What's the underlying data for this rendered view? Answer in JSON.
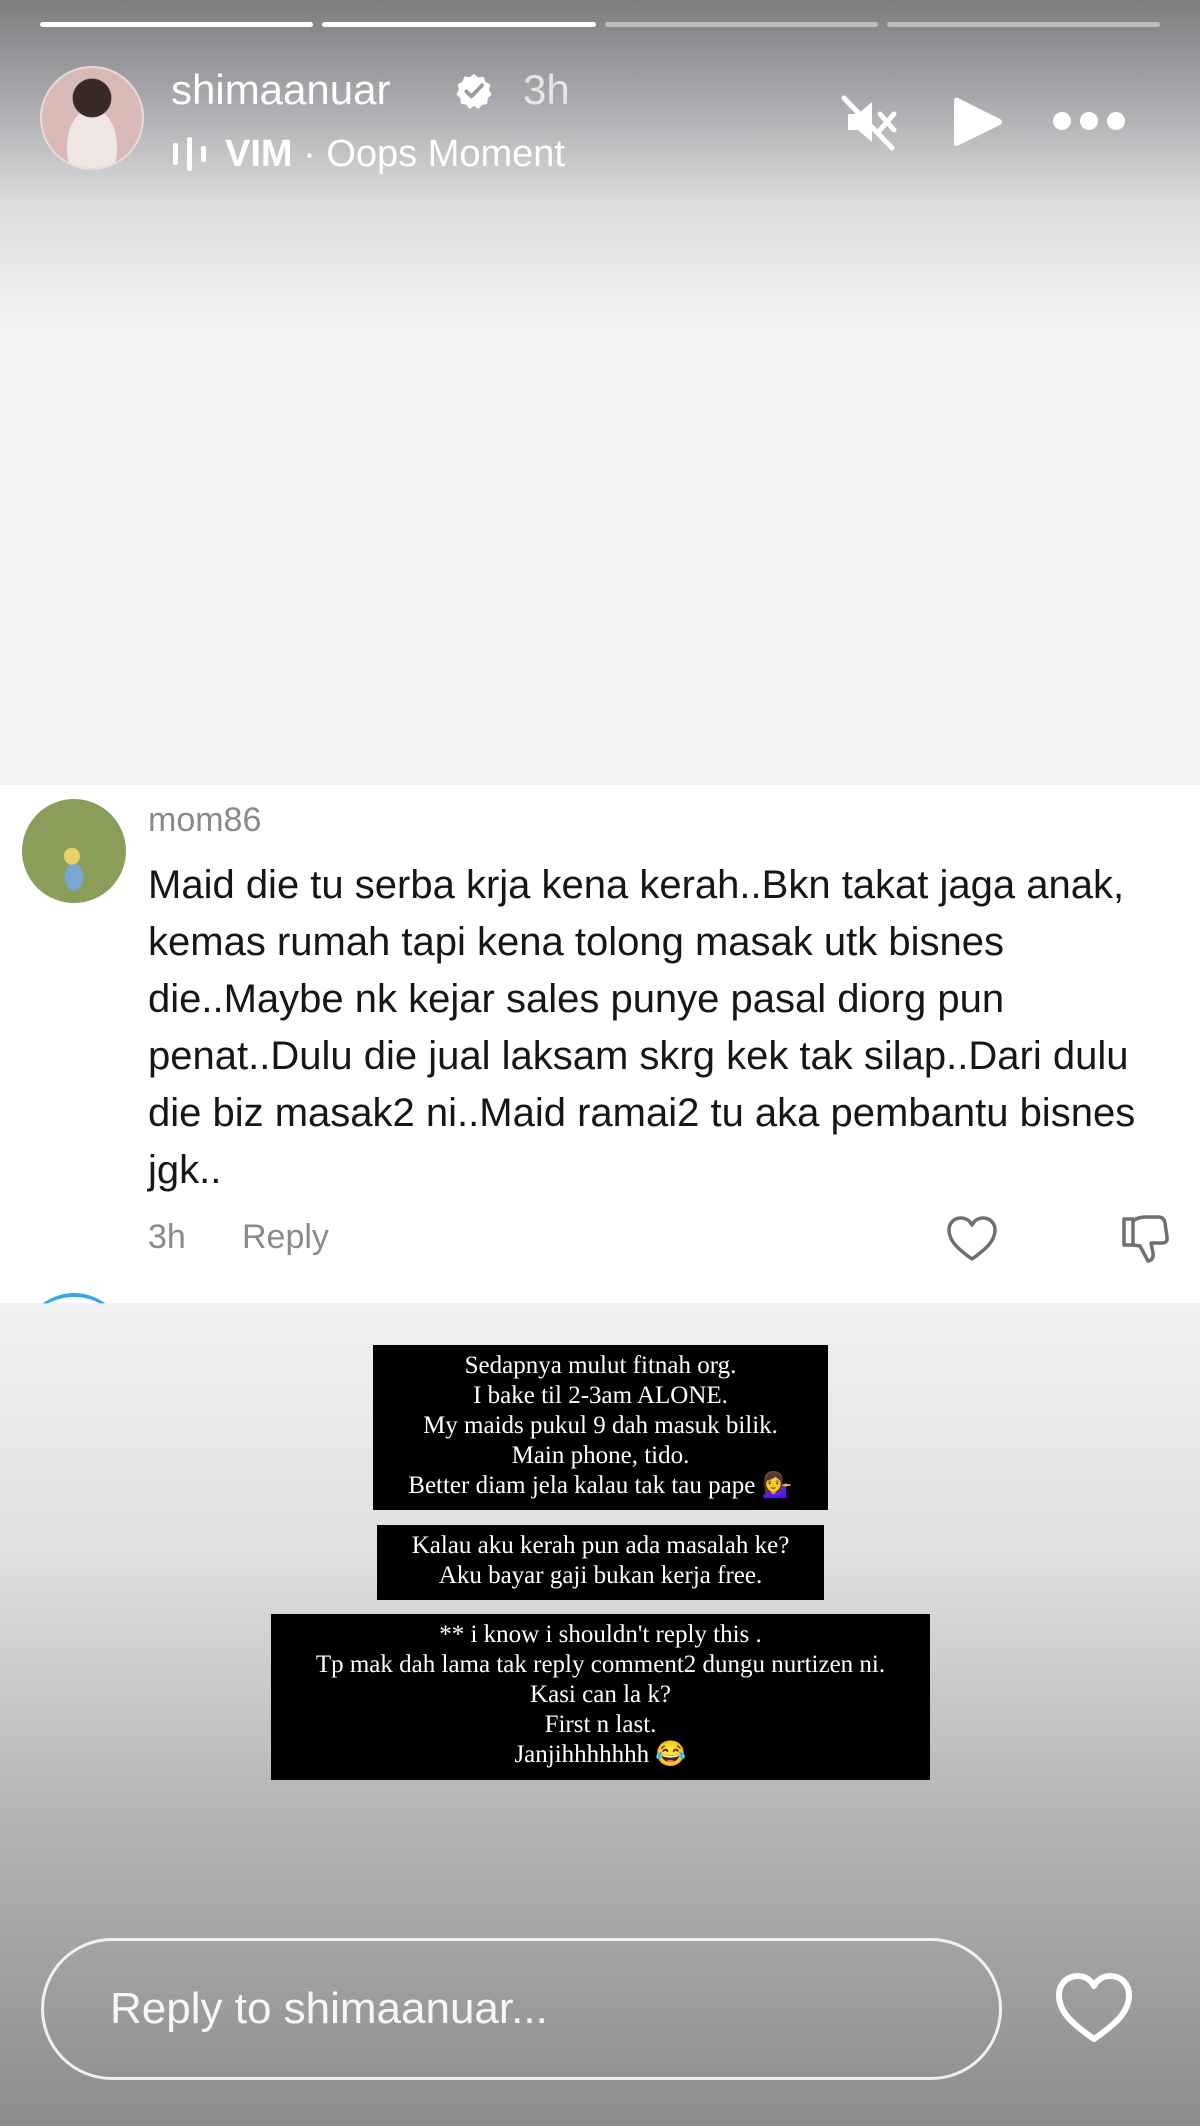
{
  "story": {
    "progress": {
      "segments": 4,
      "completed": 2,
      "current_fraction": 0.0
    },
    "username": "shimaanuar",
    "verified": true,
    "time_ago": "3h",
    "music": {
      "artist": "VIM",
      "separator": " · ",
      "title": "Oops Moment"
    },
    "controls": {
      "mute": "muted-speaker-icon",
      "play": "play-icon",
      "more": "more-icon"
    }
  },
  "comment": {
    "username": "mom86",
    "text": "Maid die tu serba krja kena kerah..Bkn takat jaga anak, kemas rumah tapi kena tolong masak utk bisnes die..Maybe nk kejar sales punye pasal diorg pun penat..Dulu die jual laksam skrg kek tak silap..Dari dulu die biz masak2 ni..Maid ramai2 tu aka pembantu bisnes jgk..",
    "time": "3h",
    "reply_label": "Reply"
  },
  "text_boxes": [
    {
      "lines": [
        "Sedapnya mulut fitnah org.",
        "I bake til 2-3am ALONE.",
        "My maids pukul 9 dah masuk bilik.",
        "Main phone, tido.",
        "Better diam jela kalau tak tau pape 💁‍♀️"
      ]
    },
    {
      "lines": [
        "Kalau aku kerah pun ada masalah ke?",
        "Aku bayar gaji bukan kerja free."
      ]
    },
    {
      "lines": [
        "** i know i shouldn't reply this .",
        "Tp mak dah lama tak reply comment2 dungu nurtizen ni.",
        "Kasi can la k?",
        "First n last.",
        "Janjihhhhhhh 😂"
      ]
    }
  ],
  "reply_bar": {
    "placeholder": "Reply to shimaanuar...",
    "like_icon": "heart-icon"
  },
  "colors": {
    "verified_badge": "#ffffff",
    "overlay_dark": "#7d7d80",
    "comment_bg": "#ffffff"
  }
}
